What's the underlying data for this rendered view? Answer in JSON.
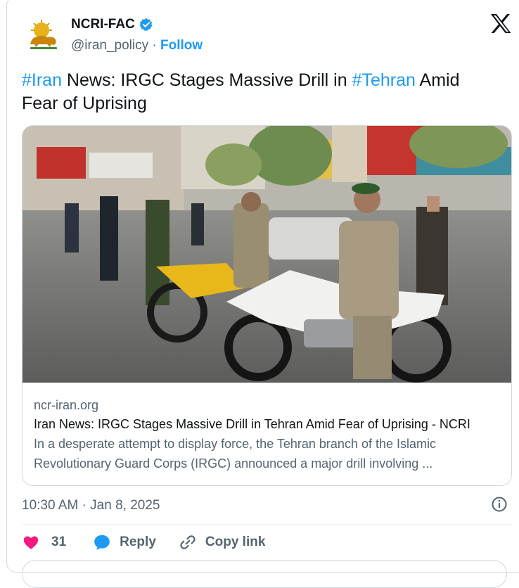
{
  "author": {
    "display_name": "NCRI-FAC",
    "handle": "@iran_policy",
    "separator": " · ",
    "follow_label": "Follow",
    "verified": true,
    "verified_color": "#1d9bf0"
  },
  "tweet": {
    "hashtag_1": "#Iran",
    "text_1": " News: IRGC Stages Massive Drill in ",
    "hashtag_2": "#Tehran",
    "text_2": " Amid Fear of Uprising"
  },
  "link_card": {
    "domain": "ncr-iran.org",
    "title": "Iran News: IRGC Stages Massive Drill in Tehran Amid Fear of Uprising - NCRI",
    "description": "In a desperate attempt to display force, the Tehran branch of the Islamic Revolutionary Guard Corps (IRGC) announced a major drill involving ...",
    "image_alt": "IRGC members on motorcycles in a Tehran street"
  },
  "meta": {
    "timestamp": "10:30 AM · Jan 8, 2025"
  },
  "actions": {
    "like_count": "31",
    "reply_label": "Reply",
    "copy_link_label": "Copy link"
  },
  "icons": {
    "logo": "x-logo-icon",
    "avatar": "lion-and-sun-emblem",
    "verified": "verified-badge-icon",
    "info": "info-icon",
    "like": "heart-icon",
    "reply": "speech-bubble-icon",
    "copy": "link-chain-icon"
  },
  "colors": {
    "accent": "#1d9bf0",
    "like": "#f91880",
    "secondary_text": "#536471",
    "border": "#cfd9de"
  }
}
